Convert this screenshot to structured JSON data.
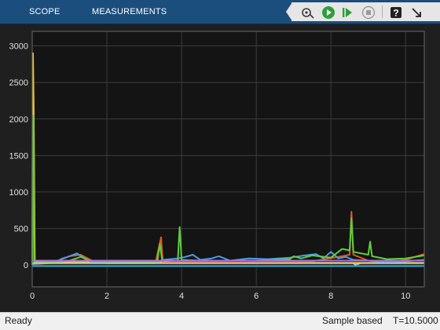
{
  "toolstrip": {
    "tabs": [
      {
        "label": "SCOPE"
      },
      {
        "label": "MEASUREMENTS"
      }
    ],
    "buttons": [
      {
        "icon": "highlight-block-icon",
        "color": "#3a3a3a"
      },
      {
        "icon": "run-icon",
        "color": "#2e9e3c"
      },
      {
        "icon": "step-forward-icon",
        "color": "#2e9e3c"
      },
      {
        "icon": "stop-icon",
        "color": "#9a9a9a"
      },
      {
        "icon": "help-icon",
        "color": "#222222"
      },
      {
        "icon": "undock-icon",
        "color": "#222222"
      }
    ]
  },
  "status": {
    "left": "Ready",
    "mode": "Sample based",
    "time": "T=10.5000"
  },
  "chart_data": {
    "type": "line",
    "title": "",
    "xlabel": "",
    "ylabel": "",
    "xlim": [
      0,
      10.5
    ],
    "ylim": [
      -300,
      3200
    ],
    "grid": true,
    "x_ticks": [
      "0",
      "2",
      "4",
      "6",
      "8",
      "10"
    ],
    "y_ticks": [
      "0",
      "500",
      "1000",
      "1500",
      "2000",
      "2500",
      "3000"
    ],
    "series": [
      {
        "color": "#f0c419",
        "points": [
          [
            0,
            0
          ],
          [
            0.02,
            2900
          ],
          [
            0.04,
            2150
          ],
          [
            0.07,
            50
          ],
          [
            0.6,
            35
          ],
          [
            1.2,
            40
          ],
          [
            3.4,
            40
          ],
          [
            4.0,
            35
          ],
          [
            6.0,
            30
          ],
          [
            8.0,
            30
          ],
          [
            8.6,
            30
          ],
          [
            10.0,
            30
          ],
          [
            10.5,
            30
          ]
        ]
      },
      {
        "color": "#e05a1e",
        "points": [
          [
            0,
            10
          ],
          [
            0.6,
            30
          ],
          [
            0.8,
            90
          ],
          [
            1.0,
            120
          ],
          [
            1.3,
            140
          ],
          [
            1.6,
            60
          ],
          [
            2.0,
            25
          ],
          [
            3.3,
            25
          ],
          [
            3.45,
            380
          ],
          [
            3.5,
            30
          ],
          [
            3.9,
            40
          ],
          [
            4.5,
            40
          ],
          [
            5.5,
            35
          ],
          [
            6.5,
            40
          ],
          [
            7.5,
            50
          ],
          [
            8.3,
            120
          ],
          [
            8.5,
            140
          ],
          [
            8.55,
            730
          ],
          [
            8.6,
            140
          ],
          [
            9.0,
            60
          ],
          [
            9.5,
            40
          ],
          [
            10.0,
            70
          ],
          [
            10.3,
            120
          ],
          [
            10.5,
            150
          ]
        ]
      },
      {
        "color": "#4a9de8",
        "points": [
          [
            0,
            10
          ],
          [
            0.3,
            30
          ],
          [
            0.6,
            45
          ],
          [
            0.9,
            100
          ],
          [
            1.2,
            160
          ],
          [
            1.4,
            90
          ],
          [
            1.6,
            40
          ],
          [
            3.3,
            30
          ],
          [
            3.5,
            70
          ],
          [
            3.9,
            90
          ],
          [
            4.1,
            110
          ],
          [
            4.3,
            140
          ],
          [
            4.5,
            70
          ],
          [
            4.8,
            90
          ],
          [
            5.0,
            120
          ],
          [
            5.3,
            60
          ],
          [
            5.8,
            90
          ],
          [
            6.3,
            80
          ],
          [
            6.9,
            100
          ],
          [
            7.3,
            130
          ],
          [
            7.6,
            150
          ],
          [
            7.8,
            90
          ],
          [
            8.0,
            180
          ],
          [
            8.2,
            90
          ],
          [
            8.4,
            110
          ],
          [
            8.6,
            70
          ],
          [
            9.0,
            60
          ],
          [
            9.4,
            40
          ],
          [
            10.0,
            50
          ],
          [
            10.5,
            70
          ]
        ]
      },
      {
        "color": "#5fcf3c",
        "points": [
          [
            0,
            0
          ],
          [
            0.01,
            2000
          ],
          [
            0.03,
            2050
          ],
          [
            0.05,
            30
          ],
          [
            0.5,
            40
          ],
          [
            1.0,
            60
          ],
          [
            1.3,
            110
          ],
          [
            1.6,
            50
          ],
          [
            3.35,
            40
          ],
          [
            3.42,
            290
          ],
          [
            3.48,
            60
          ],
          [
            3.9,
            60
          ],
          [
            3.95,
            520
          ],
          [
            4.0,
            70
          ],
          [
            4.5,
            60
          ],
          [
            5.0,
            60
          ],
          [
            5.5,
            60
          ],
          [
            6.0,
            60
          ],
          [
            6.5,
            70
          ],
          [
            6.9,
            80
          ],
          [
            7.0,
            120
          ],
          [
            7.2,
            90
          ],
          [
            7.5,
            130
          ],
          [
            8.0,
            100
          ],
          [
            8.3,
            220
          ],
          [
            8.5,
            200
          ],
          [
            8.55,
            640
          ],
          [
            8.6,
            180
          ],
          [
            9.0,
            140
          ],
          [
            9.05,
            320
          ],
          [
            9.1,
            120
          ],
          [
            9.5,
            80
          ],
          [
            10.0,
            90
          ],
          [
            10.5,
            130
          ]
        ]
      },
      {
        "color": "#b06fd6",
        "points": [
          [
            0,
            60
          ],
          [
            10.5,
            60
          ]
        ]
      },
      {
        "color": "#c8c8c8",
        "points": [
          [
            0,
            25
          ],
          [
            3.0,
            25
          ],
          [
            6.0,
            25
          ],
          [
            8.6,
            25
          ],
          [
            8.65,
            5
          ],
          [
            8.8,
            25
          ],
          [
            10.5,
            25
          ]
        ]
      },
      {
        "color": "#2fa8c4",
        "points": [
          [
            0,
            -15
          ],
          [
            10.5,
            -15
          ]
        ]
      }
    ]
  }
}
